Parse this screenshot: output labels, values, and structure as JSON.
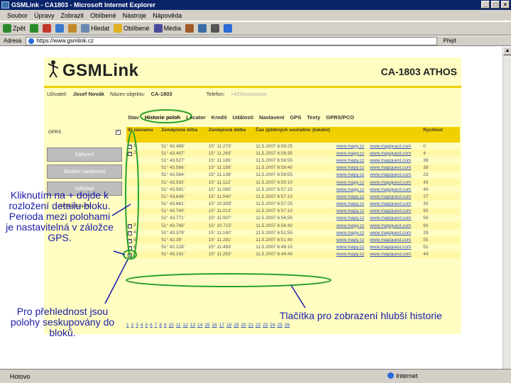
{
  "window": {
    "title": "GSMLink - CA1803 - Microsoft Internet Explorer",
    "menu": [
      "Soubor",
      "Úpravy",
      "Zobrazit",
      "Oblíbené",
      "Nástroje",
      "Nápověda"
    ],
    "toolbar": [
      "Zpět",
      "Hledat",
      "Oblíbené",
      "Média"
    ],
    "address_label": "Adresa",
    "address_value": "https://www.gsmlink.cz",
    "go_label": "Přejít",
    "status_left": "Hotovo",
    "status_zone": "Internet"
  },
  "page": {
    "logo_text": "GSMLink",
    "unit_name": "CA-1803 ATHOS",
    "user_label": "Uživatel:",
    "user_value": "Josef Novák",
    "object_label": "Název objektu:",
    "object_value": "CA-1803",
    "phone_label": "Telefon:",
    "phone_value": "+420xxxxxxxxx",
    "tabs": [
      "Stav",
      "Historie poloh",
      "Locator",
      "Kredit",
      "Události",
      "Nastavení",
      "GPS",
      "Texty",
      "GPRS/PCO"
    ],
    "sidebar": {
      "gprs_label": "GPRS",
      "buttons": [
        "Zařízení",
        "Osobní nastavení",
        "Odhlásit"
      ],
      "gprs_status": "GPRS připojeno"
    },
    "table": {
      "headers": [
        "ID záznamu",
        "Zeměpisná šířka",
        "Zeměpisná délka",
        "Čas zjištěných souřadnic (lokální)",
        "",
        "",
        "Rychlost"
      ],
      "rows": [
        {
          "id": "1",
          "plus": true,
          "lat": "51° 43.499'",
          "lon": "15° 11.273'",
          "time": "11.5.2007 6:59:25",
          "m1": "www.mapy.cz",
          "m2": "www.mapquest.com",
          "speed": "0"
        },
        {
          "id": "2",
          "plus": true,
          "lat": "51° 43.497'",
          "lon": "15° 11.263'",
          "time": "11.5.2007 6:59:35",
          "m1": "www.mapy.cz",
          "m2": "www.mapquest.com",
          "speed": "4"
        },
        {
          "id": "",
          "plus": false,
          "lat": "51° 43.527'",
          "lon": "15° 11.185'",
          "time": "11.5.2007 6:59:55",
          "m1": "www.mapy.cz",
          "m2": "www.mapquest.com",
          "speed": "39"
        },
        {
          "id": "",
          "plus": false,
          "lat": "51° 43.566'",
          "lon": "15° 11.156'",
          "time": "11.5.2007 6:59:40",
          "m1": "www.mapy.cz",
          "m2": "www.mapquest.com",
          "speed": "38"
        },
        {
          "id": "",
          "plus": false,
          "lat": "51° 43.564'",
          "lon": "15° 11.138'",
          "time": "11.5.2007 6:59:55",
          "m1": "www.mapy.cz",
          "m2": "www.mapquest.com",
          "speed": "23"
        },
        {
          "id": "",
          "plus": false,
          "lat": "51° 43.592'",
          "lon": "15° 11.112'",
          "time": "11.5.2007 6:50:10",
          "m1": "www.mapy.cz",
          "m2": "www.mapquest.com",
          "speed": "43"
        },
        {
          "id": "",
          "plus": false,
          "lat": "51° 43.591'",
          "lon": "15° 11.065'",
          "time": "11.5.2007 6:57:15",
          "m1": "www.mapy.cz",
          "m2": "www.mapquest.com",
          "speed": "40"
        },
        {
          "id": "",
          "plus": false,
          "lat": "51° 43.648'",
          "lon": "15° 11.040'",
          "time": "11.5.2007 6:57:10",
          "m1": "www.mapy.cz",
          "m2": "www.mapquest.com",
          "speed": "27"
        },
        {
          "id": "",
          "plus": false,
          "lat": "51° 43.661'",
          "lon": "15° 10.939'",
          "time": "11.5.2007 6:57:25",
          "m1": "www.mapy.cz",
          "m2": "www.mapquest.com",
          "speed": "20"
        },
        {
          "id": "",
          "plus": false,
          "lat": "51° 43.740'",
          "lon": "15° 11.013'",
          "time": "11.5.2007 6:57:10",
          "m1": "www.mapy.cz",
          "m2": "www.mapquest.com",
          "speed": "50"
        },
        {
          "id": "",
          "plus": false,
          "lat": "51° 43.771'",
          "lon": "15° 11.007'",
          "time": "11.5.2007 6:56:55",
          "m1": "www.mapy.cz",
          "m2": "www.mapquest.com",
          "speed": "50"
        },
        {
          "id": "3",
          "plus": true,
          "lat": "51° 43.766'",
          "lon": "15° 10.715'",
          "time": "11.5.2007 6:56:40",
          "m1": "www.mapy.cz",
          "m2": "www.mapquest.com",
          "speed": "60"
        },
        {
          "id": "4",
          "plus": true,
          "lat": "51° 43.379'",
          "lon": "15° 11.160'",
          "time": "11.5.2007 6:51:55",
          "m1": "www.mapy.cz",
          "m2": "www.mapquest.com",
          "speed": "29"
        },
        {
          "id": "5",
          "plus": true,
          "lat": "51° 42.39'",
          "lon": "15° 11.281'",
          "time": "11.5.2007 6:51:40",
          "m1": "www.mapy.cz",
          "m2": "www.mapquest.com",
          "speed": "55"
        },
        {
          "id": "6",
          "plus": true,
          "lat": "51° 42.129'",
          "lon": "15° 11.493'",
          "time": "11.5.2007 6:49:10",
          "m1": "www.mapy.cz",
          "m2": "www.mapquest.com",
          "speed": "51"
        },
        {
          "id": "7",
          "plus": true,
          "lat": "51° 43.191'",
          "lon": "15° 11.253'",
          "time": "11.5.2007 6:44:40",
          "m1": "www.mapy.cz",
          "m2": "www.mapquest.com",
          "speed": "44"
        }
      ]
    },
    "pager": [
      "1",
      "2",
      "3",
      "4",
      "5",
      "6",
      "7",
      "8",
      "9",
      "10",
      "11",
      "12",
      "13",
      "14",
      "15",
      "16",
      "17",
      "18",
      "19",
      "20",
      "21",
      "22",
      "23",
      "24",
      "25",
      "26"
    ]
  },
  "annotations": {
    "left_top": "Kliknutím na + dojde k rozložení detailu bloku. Perioda mezi polohami je nastavitelná v záložce GPS.",
    "left_bottom": "Pro přehlednost jsou polohy seskupovány do bloků.",
    "right_bottom": "Tlačítka pro zobrazení hlubší historie"
  },
  "colors": {
    "page_bg": "#fffdc2",
    "accent_yellow": "#f0d000",
    "highlight_green": "#2ca02c",
    "annotation_blue": "#1a1aa8"
  }
}
